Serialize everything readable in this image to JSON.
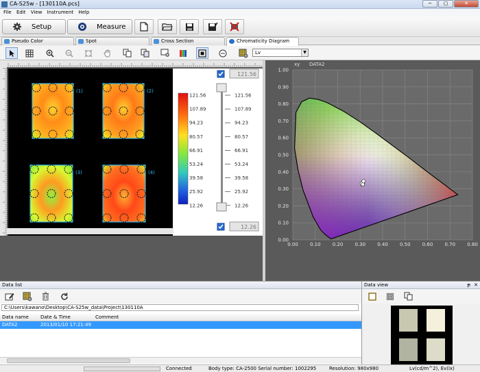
{
  "window": {
    "title": "CA-S25w - [130110A.pcs]",
    "min": "─",
    "max": "▢",
    "close": "✕"
  },
  "menu": [
    "File",
    "Edit",
    "View",
    "Instrument",
    "Help"
  ],
  "modes": {
    "setup": "Setup",
    "measure": "Measure"
  },
  "tabs": [
    "Pseudo Color",
    "Spot",
    "Cross Section",
    "Chromaticity Diagram"
  ],
  "select": {
    "value": "Lv"
  },
  "pseudo": {
    "areas": [
      {
        "label": "(1)",
        "colors": [
          "#ffd430",
          "#ff8c18",
          "#ffb020",
          "#c8ff20"
        ]
      },
      {
        "label": "(2)",
        "colors": [
          "#ffd030",
          "#ff7a18",
          "#ffa020",
          "#e8ff20"
        ]
      },
      {
        "label": "(3)",
        "colors": [
          "#90f040",
          "#ff9a20",
          "#d8f830",
          "#78e840"
        ]
      },
      {
        "label": "(4)",
        "colors": [
          "#ffb030",
          "#ff4818",
          "#ff7020",
          "#d0f830"
        ]
      }
    ],
    "scale_labels": [
      "121.56",
      "107.89",
      "94.23",
      "80.57",
      "66.91",
      "53.24",
      "39.58",
      "25.92",
      "12.26"
    ],
    "max_value": "121.56",
    "min_value": "12.26"
  },
  "chart_data": {
    "type": "scatter",
    "title": "DATA2",
    "ylabel": "xy",
    "xlabel": "",
    "xlim": [
      0.0,
      0.8
    ],
    "ylim": [
      0.0,
      1.0
    ],
    "x_ticks": [
      "0.00",
      "0.10",
      "0.20",
      "0.30",
      "0.40",
      "0.50",
      "0.60",
      "0.70",
      "0.80"
    ],
    "y_ticks": [
      "0.00",
      "0.10",
      "0.20",
      "0.30",
      "0.40",
      "0.50",
      "0.60",
      "0.70",
      "0.80",
      "0.90",
      "1.00"
    ],
    "locus": [
      [
        0.17,
        0.005
      ],
      [
        0.145,
        0.03
      ],
      [
        0.124,
        0.058
      ],
      [
        0.091,
        0.133
      ],
      [
        0.045,
        0.295
      ],
      [
        0.023,
        0.413
      ],
      [
        0.008,
        0.538
      ],
      [
        0.014,
        0.75
      ],
      [
        0.039,
        0.812
      ],
      [
        0.074,
        0.834
      ],
      [
        0.114,
        0.826
      ],
      [
        0.155,
        0.806
      ],
      [
        0.229,
        0.754
      ],
      [
        0.302,
        0.692
      ],
      [
        0.373,
        0.624
      ],
      [
        0.444,
        0.555
      ],
      [
        0.513,
        0.487
      ],
      [
        0.575,
        0.424
      ],
      [
        0.627,
        0.372
      ],
      [
        0.666,
        0.334
      ],
      [
        0.692,
        0.308
      ],
      [
        0.7347,
        0.2653
      ]
    ],
    "points": [
      {
        "x": 0.31,
        "y": 0.33
      },
      {
        "x": 0.315,
        "y": 0.345
      },
      {
        "x": 0.312,
        "y": 0.326
      }
    ],
    "grid": true
  },
  "datalist": {
    "title": "Data list",
    "path": "C:\\Users\\kawano\\Desktop\\CA-S25w_data\\Project\\130110A",
    "columns": [
      "Data name",
      "Date & Time",
      "Comment"
    ],
    "rows": [
      {
        "name": "DATA2",
        "datetime": "2013/01/10 17:21:49",
        "comment": ""
      }
    ]
  },
  "dataview": {
    "title": "Data view",
    "pin": "ᵽ",
    "close": "✕"
  },
  "status": {
    "connection": "Connected",
    "body": "Body type: CA-2500 Serial number: 1002295",
    "resolution": "Resolution: 980x980",
    "units": "Lv(cd/m^2),  Ev(lx)"
  },
  "colors": {
    "selection": "#3399ff",
    "roi": "#30b8f0",
    "background": "#5a5a5a"
  }
}
